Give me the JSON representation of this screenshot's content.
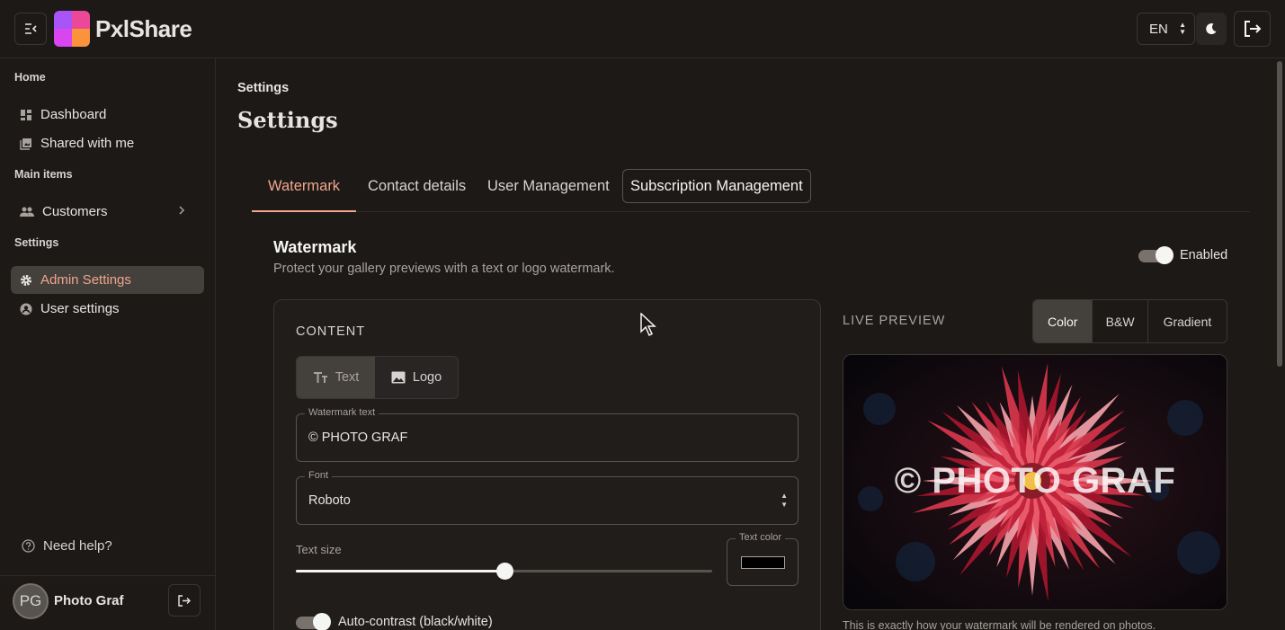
{
  "header": {
    "brand": "PxlShare",
    "language": "EN"
  },
  "sidebar": {
    "sections": [
      {
        "title": "Home"
      },
      {
        "title": "Main items"
      },
      {
        "title": "Settings"
      }
    ],
    "items": [
      {
        "label": "Dashboard",
        "icon": "dashboard-icon"
      },
      {
        "label": "Shared with me",
        "icon": "image-stack-icon"
      },
      {
        "label": "Customers",
        "icon": "people-icon"
      },
      {
        "label": "Admin Settings",
        "icon": "gear-icon",
        "active": true
      },
      {
        "label": "User settings",
        "icon": "account-circle-icon"
      }
    ],
    "help": "Need help?",
    "user": {
      "initials": "PG",
      "name": "Photo Graf"
    }
  },
  "main": {
    "breadcrumb": "Settings",
    "title": "Settings",
    "tabs": [
      {
        "label": "Watermark",
        "active": true
      },
      {
        "label": "Contact details"
      },
      {
        "label": "User Management"
      },
      {
        "label": "Subscription Management"
      }
    ],
    "watermark": {
      "title": "Watermark",
      "subtitle": "Protect your gallery previews with a text or logo watermark.",
      "enabled_label": "Enabled"
    },
    "content": {
      "heading": "CONTENT",
      "mode_options": [
        "Text",
        "Logo"
      ],
      "selected_mode": "Text",
      "watermark_text_label": "Watermark text",
      "watermark_text_value": "© PHOTO GRAF",
      "font_label": "Font",
      "font_value": "Roboto",
      "text_size_label": "Text size",
      "text_size_fraction": 0.5,
      "text_color_label": "Text color",
      "text_color": "#000000",
      "auto_contrast_label": "Auto-contrast (black/white)"
    },
    "preview": {
      "heading": "LIVE PREVIEW",
      "modes": [
        "Color",
        "B&W",
        "Gradient"
      ],
      "selected_mode": "Color",
      "watermark_overlay": "© PHOTO GRAF",
      "caption": "This is exactly how your watermark will be rendered on photos."
    }
  },
  "colors": {
    "background": "#1c1917",
    "accent": "#f0a58c"
  }
}
